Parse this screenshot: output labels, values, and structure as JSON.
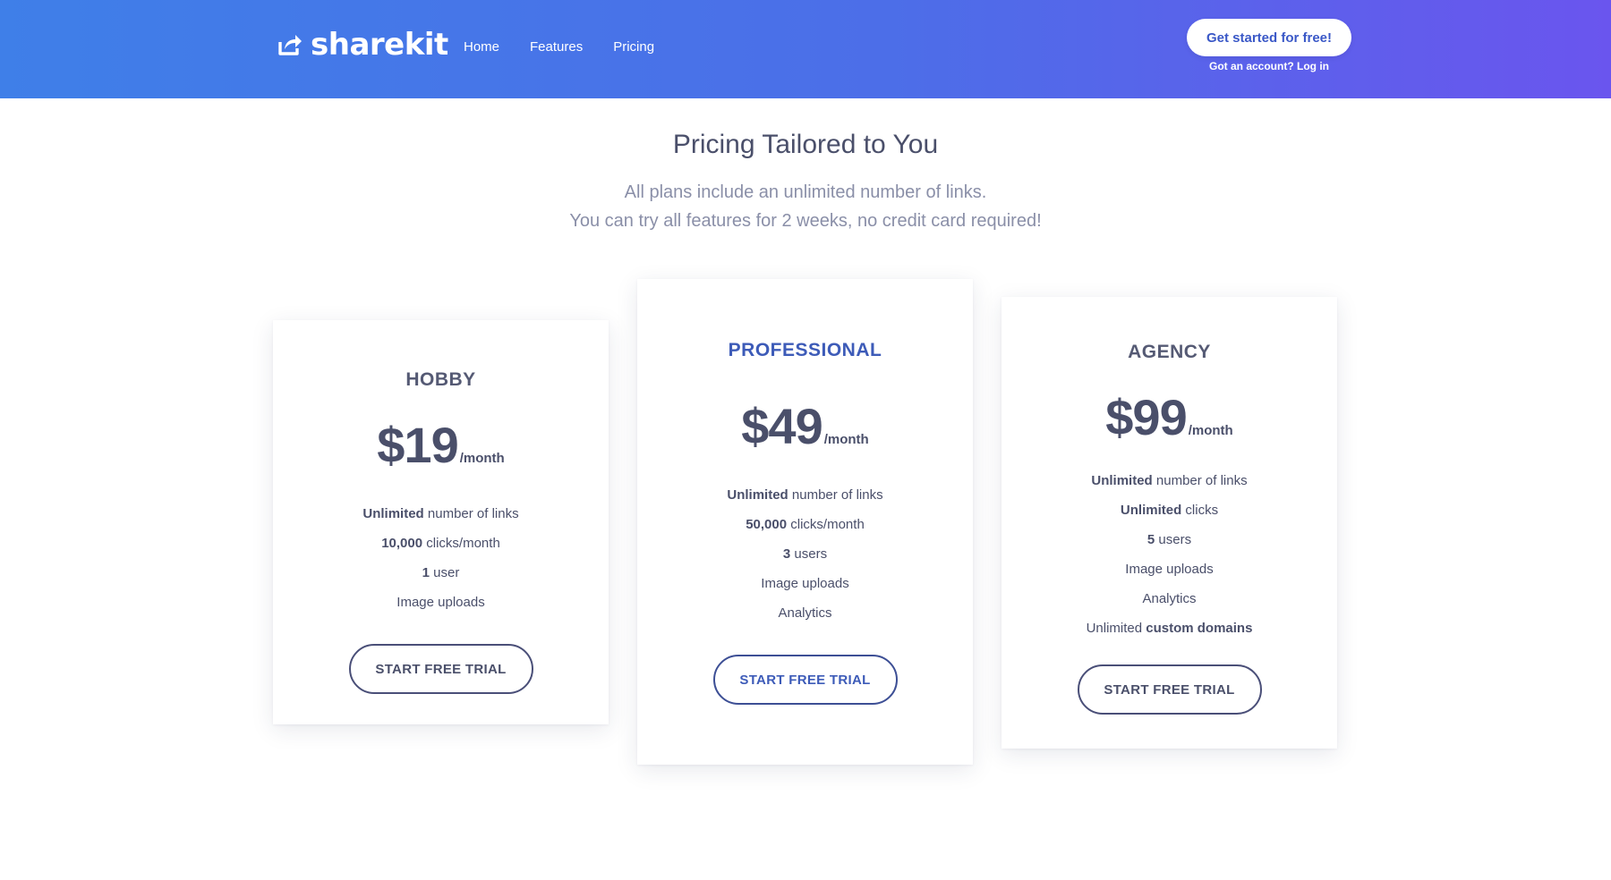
{
  "header": {
    "logo_text": "sharekit",
    "logo_icon": "share-icon",
    "nav": [
      "Home",
      "Features",
      "Pricing"
    ],
    "cta_label": "Get started for free!",
    "login_note": "Got an account? Log in",
    "gradient": [
      "#3f7fe8",
      "#6a55ee"
    ]
  },
  "intro": {
    "title": "Pricing Tailored to You",
    "subtitle_line1": "All plans include an unlimited number of links.",
    "subtitle_line2": "You can try all features for 2 weeks, no credit card required!"
  },
  "plans": [
    {
      "name": "HOBBY",
      "price": "$19",
      "period": "/month",
      "features": [
        {
          "bold": "Unlimited",
          "rest": " number of links"
        },
        {
          "bold": "10,000",
          "rest": " clicks/month"
        },
        {
          "bold": "1",
          "rest": " user"
        },
        {
          "bold": "",
          "rest": "Image uploads"
        }
      ],
      "button": "START FREE TRIAL"
    },
    {
      "name": "PROFESSIONAL",
      "price": "$49",
      "period": "/month",
      "features": [
        {
          "bold": "Unlimited",
          "rest": " number of links"
        },
        {
          "bold": "50,000",
          "rest": " clicks/month"
        },
        {
          "bold": "3",
          "rest": " users"
        },
        {
          "bold": "",
          "rest": "Image uploads"
        },
        {
          "bold": "",
          "rest": "Analytics"
        }
      ],
      "button": "START FREE TRIAL"
    },
    {
      "name": "AGENCY",
      "price": "$99",
      "period": "/month",
      "features": [
        {
          "bold": "Unlimited",
          "rest": " number of links"
        },
        {
          "bold": "Unlimited",
          "rest": " clicks"
        },
        {
          "bold": "5",
          "rest": " users"
        },
        {
          "bold": "",
          "rest": "Image uploads"
        },
        {
          "bold": "",
          "rest": "Analytics"
        },
        {
          "prefix": "Unlimited ",
          "bold": "custom domains",
          "rest": ""
        }
      ],
      "button": "START FREE TRIAL"
    }
  ],
  "colors": {
    "accent": "#3d5bb8",
    "text": "#4a4f6a",
    "muted": "#8a8fa8"
  }
}
